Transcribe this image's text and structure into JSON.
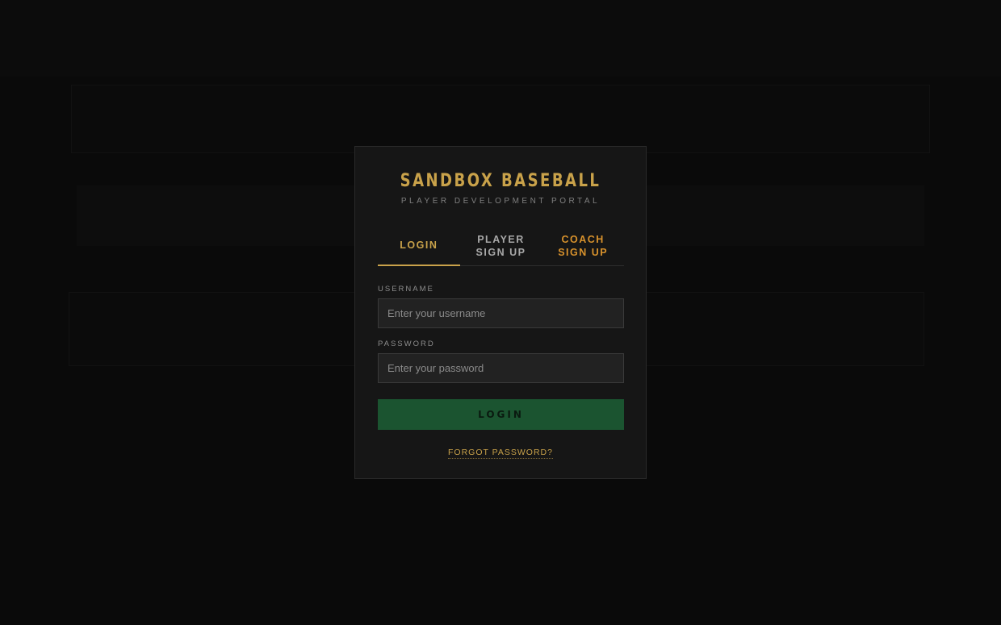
{
  "modal": {
    "title": "SANDBOX BASEBALL",
    "subtitle": "PLAYER DEVELOPMENT PORTAL",
    "tabs": [
      {
        "label": "LOGIN"
      },
      {
        "label": "PLAYER SIGN UP"
      },
      {
        "label": "COACH SIGN UP"
      }
    ],
    "username_label": "USERNAME",
    "username_placeholder": "Enter your username",
    "password_label": "PASSWORD",
    "password_placeholder": "Enter your password",
    "login_button": "LOGIN",
    "forgot_link": "FORGOT PASSWORD?"
  },
  "colors": {
    "accent_gold": "#c9a24a",
    "accent_orange": "#d8922c",
    "button_green": "#1b5430",
    "modal_bg": "#161616"
  }
}
